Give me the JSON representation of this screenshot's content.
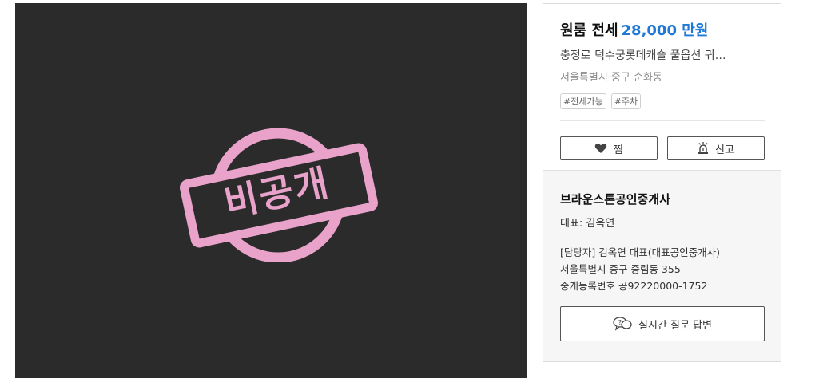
{
  "listing": {
    "title": "원룸 전세",
    "price": "28,000 만원",
    "description": "충정로 덕수궁롯데캐슬 풀옵션 귀…",
    "address": "서울특별시 중구 순화동",
    "tags": [
      "#전세가능",
      "#주차"
    ]
  },
  "photo": {
    "stamp_text": "비공개",
    "stamp_color": "#e9a3ca",
    "background": "#2b2b2b"
  },
  "actions": {
    "favorite_label": "찜",
    "favorite_icon": "heart-icon",
    "report_label": "신고",
    "report_icon": "siren-icon"
  },
  "agent": {
    "name": "브라운스톤공인중개사",
    "representative": "대표: 김옥연",
    "manager": "[담당자]  김옥연 대표(대표공인중개사)",
    "office_address": "서울특별시 중구 중림동 355",
    "registration": "중개등록번호 공92220000-1752",
    "qa_label": "실시간 질문 답변",
    "qa_icon": "chat-question-icon"
  },
  "colors": {
    "accent": "#1e78d6",
    "muted": "#8a8a8a"
  }
}
